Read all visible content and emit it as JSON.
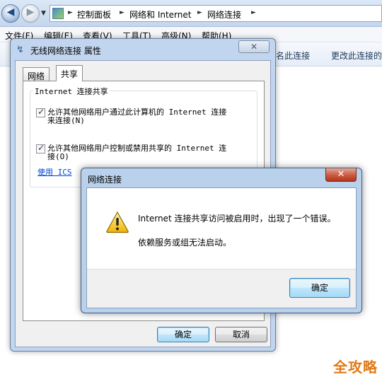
{
  "explorer": {
    "breadcrumbs": [
      "控制面板",
      "网络和 Internet",
      "网络连接"
    ],
    "menu": [
      "文件(F)",
      "编辑(E)",
      "查看(V)",
      "工具(T)",
      "高级(N)",
      "帮助(H)"
    ],
    "toolbar": [
      "名此连接",
      "更改此连接的"
    ]
  },
  "properties_dialog": {
    "title": "无线网络连接 属性",
    "tabs": [
      "网络",
      "共享"
    ],
    "group_title": "Internet 连接共享",
    "checkbox1_line1": "允许其他网络用户通过此计算机的 Internet 连接",
    "checkbox1_line2": "来连接(N)",
    "checkbox2_line1": "允许其他网络用户控制或禁用共享的 Internet 连",
    "checkbox2_line2": "接(O)",
    "ics_link": "使用 ICS",
    "ok_label": "确定",
    "cancel_label": "取消"
  },
  "error_dialog": {
    "title": "网络连接",
    "message": "Internet 连接共享访问被启用时，出现了一个错误。",
    "detail": "依赖服务或组无法启动。",
    "ok_label": "确定"
  },
  "watermark": "全攻略"
}
